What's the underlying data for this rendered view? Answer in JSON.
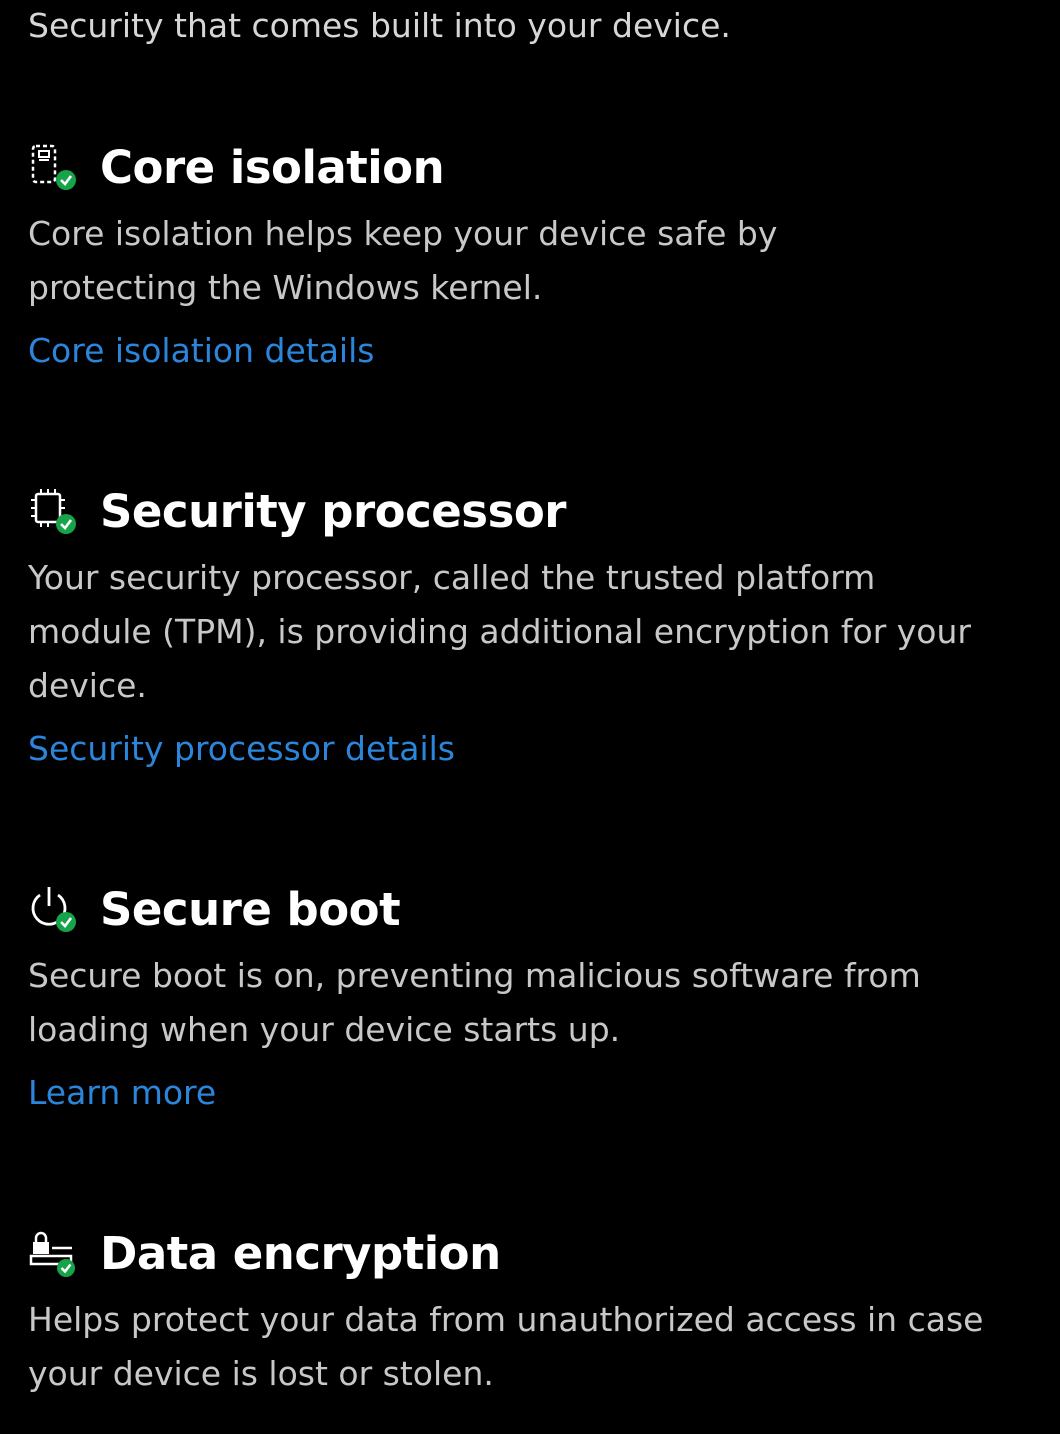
{
  "intro": "Security that comes built into your device.",
  "colors": {
    "background": "#000000",
    "title": "#ffffff",
    "description": "#c8c8c8",
    "link": "#2b86db",
    "status_ok": "#16a34a"
  },
  "sections": [
    {
      "id": "core-isolation",
      "icon": "core-isolation-icon",
      "status_icon": "check-badge-icon",
      "title": "Core isolation",
      "description": "Core isolation helps keep your device safe by protecting the Windows kernel.",
      "link": "Core isolation details"
    },
    {
      "id": "security-processor",
      "icon": "security-processor-icon",
      "status_icon": "check-badge-icon",
      "title": "Security processor",
      "description": "Your security processor, called the trusted platform module (TPM), is providing additional encryption for your device.",
      "link": "Security processor details"
    },
    {
      "id": "secure-boot",
      "icon": "power-icon",
      "status_icon": "check-badge-icon",
      "title": "Secure boot",
      "description": "Secure boot is on, preventing malicious software from loading when your device starts up.",
      "link": "Learn more"
    },
    {
      "id": "data-encryption",
      "icon": "lock-drive-icon",
      "status_icon": "check-badge-icon",
      "title": "Data encryption",
      "description": "Helps protect your data from unauthorized access in case your device is lost or stolen."
    }
  ]
}
